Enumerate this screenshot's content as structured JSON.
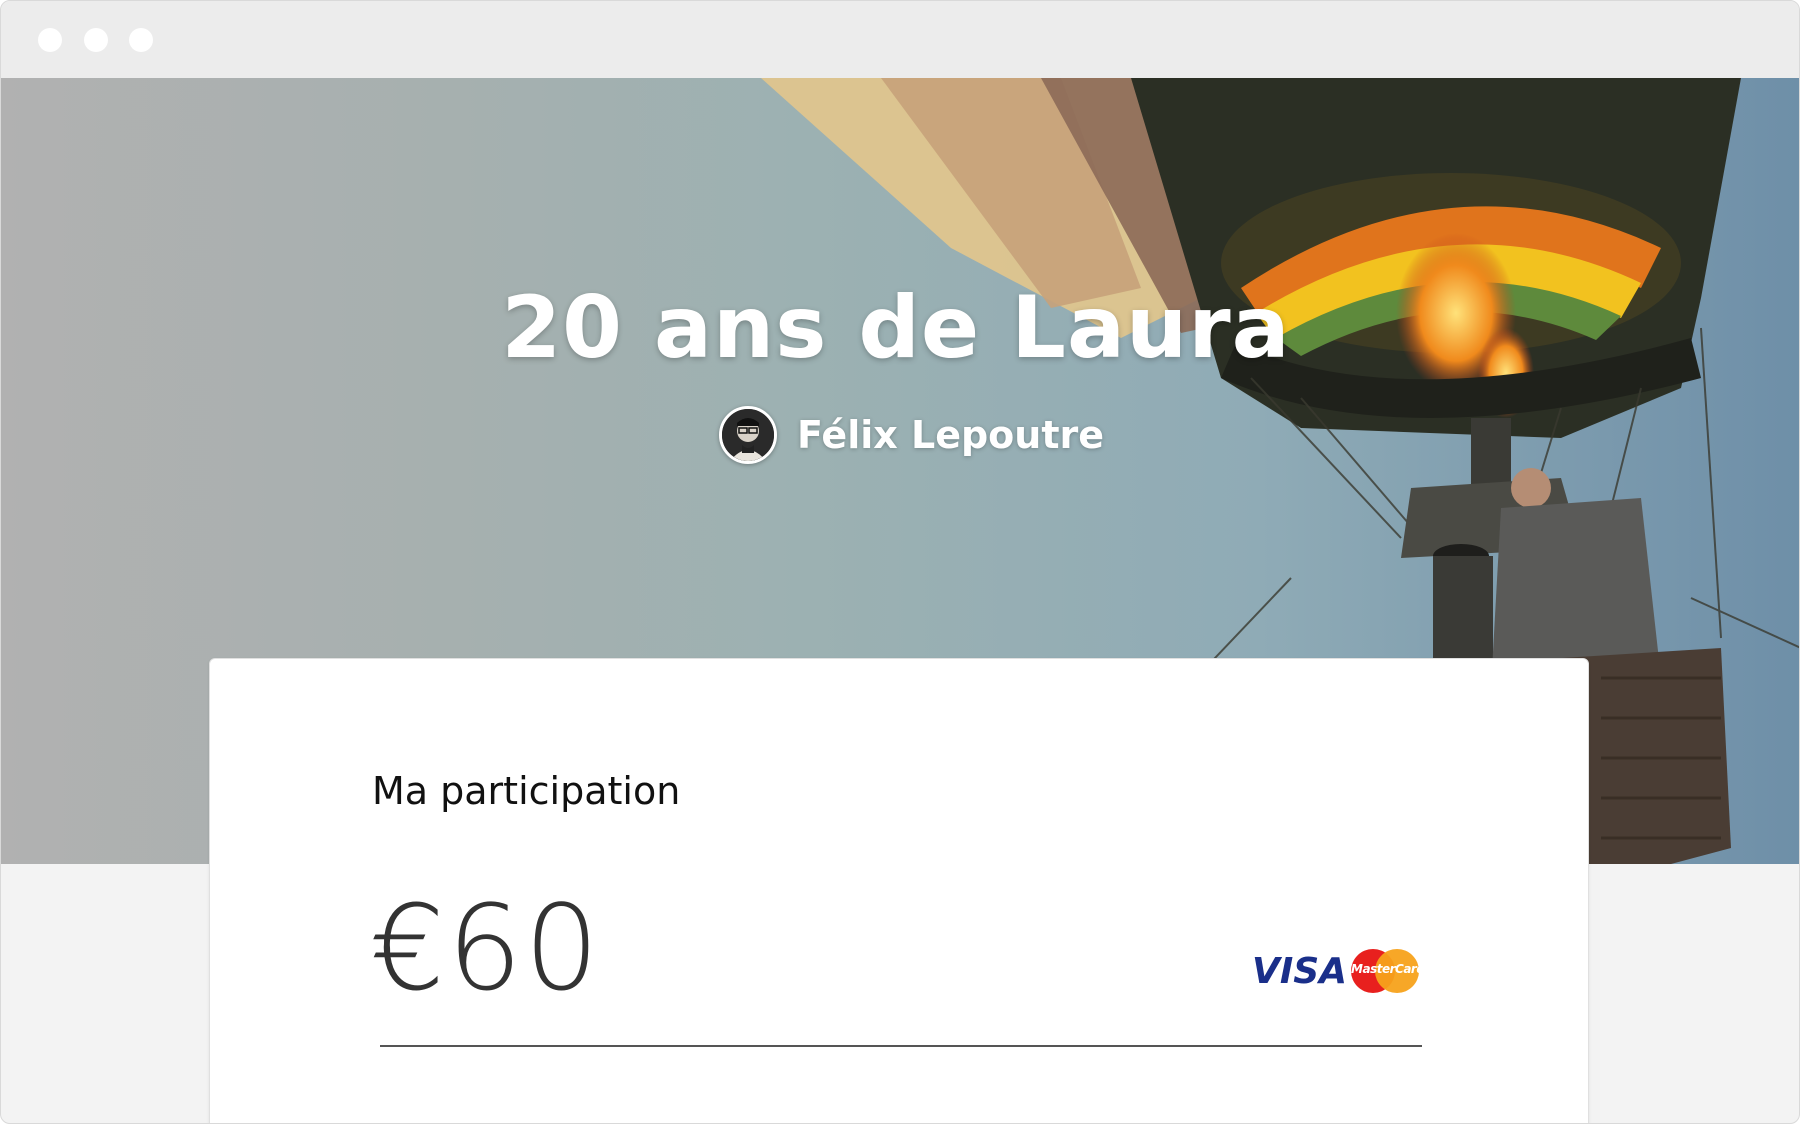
{
  "hero": {
    "title": "20 ans de Laura",
    "author_name": "Félix Lepoutre"
  },
  "card": {
    "label": "Ma participation",
    "amount": "€60",
    "payment_logos": {
      "visa": "VISA",
      "mastercard": "MasterCard"
    }
  },
  "colors": {
    "visa_blue": "#1a2f8a",
    "mastercard_red": "#e8201e",
    "mastercard_orange": "#f7a21b"
  }
}
